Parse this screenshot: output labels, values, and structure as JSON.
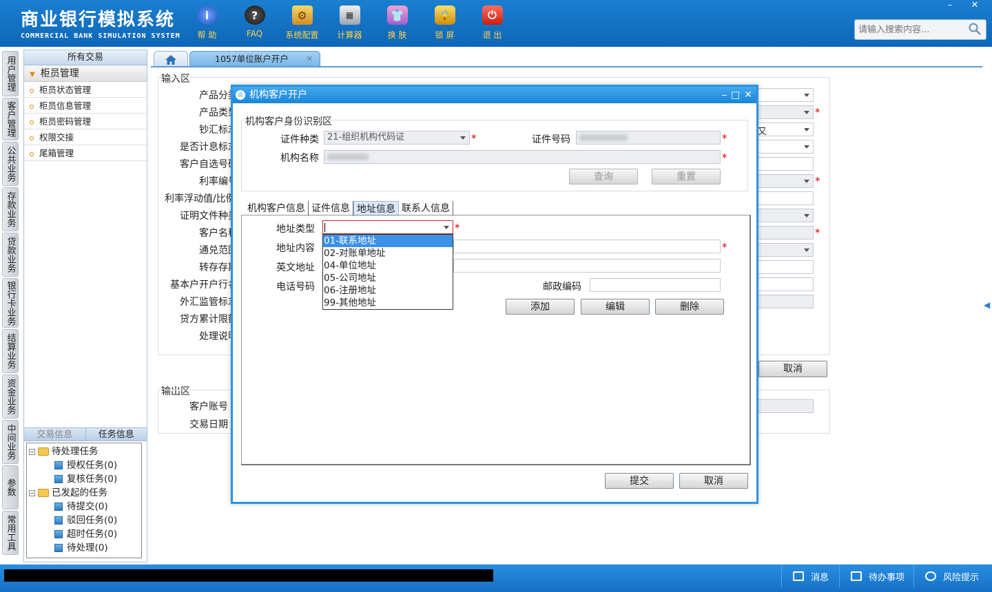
{
  "app": {
    "title_cn": "商业银行模拟系统",
    "title_en": "COMMERCIAL BANK SIMULATION SYSTEM",
    "window_controls": {
      "minimize": "–",
      "close": "✕"
    },
    "search_placeholder": "请输入搜索内容..."
  },
  "toolbar": [
    {
      "label": "帮 助",
      "icon": "help-icon",
      "glyph": "i"
    },
    {
      "label": "FAQ",
      "icon": "faq-icon",
      "glyph": "?"
    },
    {
      "label": "系统配置",
      "icon": "config-icon",
      "glyph": "⚙"
    },
    {
      "label": "计算器",
      "icon": "calculator-icon",
      "glyph": "▦"
    },
    {
      "label": "换 肤",
      "icon": "skin-icon",
      "glyph": "👕"
    },
    {
      "label": "锁 屏",
      "icon": "lock-icon",
      "glyph": "🔒"
    },
    {
      "label": "退 出",
      "icon": "exit-icon",
      "glyph": "⏻"
    }
  ],
  "vnav": [
    "用户管理",
    "客户管理",
    "公共业务",
    "存款业务",
    "贷款业务",
    "银行卡业务",
    "结算业务",
    "资金业务",
    "中间业务",
    "参数",
    "常用工具"
  ],
  "left_panel": {
    "header": "所有交易",
    "group": "柜员管理",
    "items": [
      "柜员状态管理",
      "柜员信息管理",
      "柜员密码管理",
      "权限交接",
      "尾箱管理"
    ],
    "tabs": [
      "交易信息",
      "任务信息"
    ],
    "tree": {
      "pending": "待处理任务",
      "pending_children": [
        "授权任务(0)",
        "复核任务(0)"
      ],
      "initiated": "已发起的任务",
      "initiated_children": [
        "待提交(0)",
        "驳回任务(0)",
        "超时任务(0)",
        "待处理(0)"
      ]
    }
  },
  "page_tab": {
    "label": "1057单位账户开户",
    "close": "✕"
  },
  "form": {
    "input_section": "输入区",
    "output_section": "输出区",
    "labels": [
      "产品分类",
      "产品类型",
      "钞汇标志",
      "是否计息标志",
      "客户自选号码",
      "利率编号",
      "利率浮动值/比例",
      "证明文件种类",
      "客户名称",
      "通兑范围",
      "转存存期",
      "基本户开户行名",
      "外汇监管标志",
      "贷方累计限额",
      "处理说明"
    ],
    "cancel_button": "取消",
    "output_labels": [
      "客户账号",
      "交易日期"
    ],
    "partial_text": "又"
  },
  "modal": {
    "title": "机构客户开户",
    "id_section": "机构客户身份识别区",
    "cert_type_label": "证件种类",
    "cert_type_value": "21-组织机构代码证",
    "cert_no_label": "证件号码",
    "org_name_label": "机构名称",
    "query_button": "查询",
    "reset_button": "重置",
    "tabs": [
      "机构客户信息",
      "证件信息",
      "地址信息",
      "联系人信息"
    ],
    "addr_type_label": "地址类型",
    "addr_content_label": "地址内容",
    "en_addr_label": "英文地址",
    "phone_label": "电话号码",
    "postcode_label": "邮政编码",
    "add_button": "添加",
    "edit_button": "编辑",
    "delete_button": "删除",
    "submit_button": "提交",
    "cancel_button": "取消",
    "addr_type_options": [
      "01-联系地址",
      "02-对账单地址",
      "04-单位地址",
      "05-公司地址",
      "06-注册地址",
      "99-其他地址"
    ],
    "required_mark": "*"
  },
  "statusbar": {
    "message": "消息",
    "todo": "待办事项",
    "risk": "风险提示"
  },
  "colors": {
    "header_blue": "#1273c4",
    "accent_blue": "#2e93e1",
    "required_red": "#d20000",
    "toolbar_label": "#ffd24a"
  }
}
